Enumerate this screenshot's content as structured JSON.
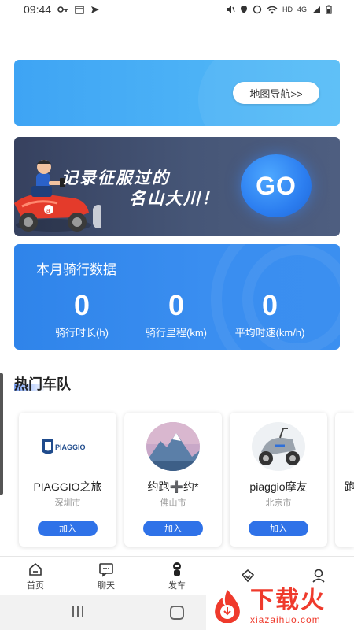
{
  "status_bar": {
    "time": "09:44",
    "net_label": "HD",
    "signal_label": "4G"
  },
  "map_banner": {
    "nav_button": "地图导航>>"
  },
  "go_banner": {
    "slogan_line1": "记录征服过的",
    "slogan_line2": "名山大川！",
    "go_label": "GO"
  },
  "monthly_stats": {
    "title": "本月骑行数据",
    "items": [
      {
        "value": "0",
        "label": "骑行时长(h)"
      },
      {
        "value": "0",
        "label": "骑行里程(km)"
      },
      {
        "value": "0",
        "label": "平均时速(km/h)"
      }
    ]
  },
  "hot_teams": {
    "title": "热门车队",
    "join_label": "加入",
    "teams": [
      {
        "name": "PIAGGIO之旅",
        "city": "深圳市",
        "logo_text": "PIAGGIO"
      },
      {
        "name": "约跑➕约*",
        "city": "佛山市"
      },
      {
        "name": "piaggio摩友",
        "city": "北京市"
      },
      {
        "name": "跑"
      }
    ]
  },
  "tab_bar": {
    "items": [
      {
        "label": "首页",
        "icon": "home-icon"
      },
      {
        "label": "聊天",
        "icon": "chat-icon"
      },
      {
        "label": "发车",
        "icon": "rider-icon"
      },
      {
        "label": "",
        "icon": "tag-icon"
      },
      {
        "label": "",
        "icon": "profile-icon"
      }
    ]
  },
  "watermark": {
    "main": "下载火",
    "sub": "xiazaihuo.com"
  },
  "colors": {
    "accent_blue": "#2f72e8",
    "watermark_red": "#ef3a2c"
  }
}
